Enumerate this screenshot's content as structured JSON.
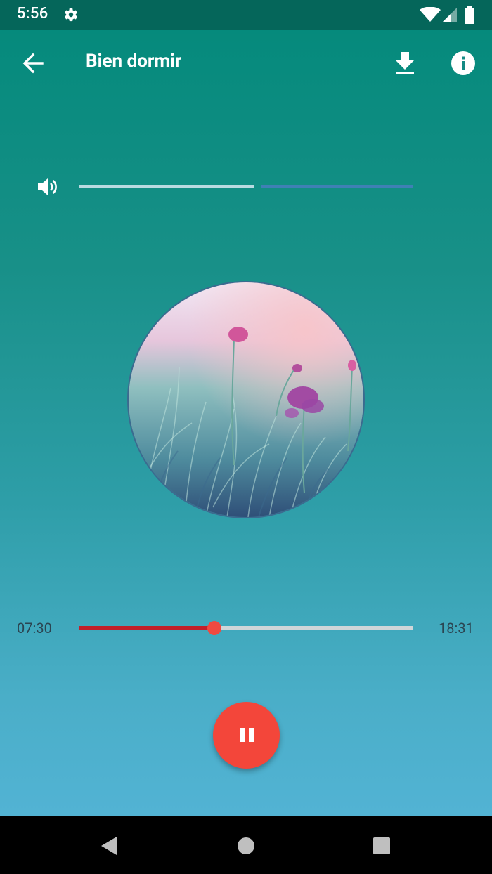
{
  "status_bar": {
    "time": "5:56",
    "icons": [
      "gear-icon",
      "wifi-icon",
      "cellular-signal-icon",
      "battery-icon"
    ]
  },
  "toolbar": {
    "title": "Bien dormir",
    "back_icon": "arrow-left-icon",
    "download_icon": "download-icon",
    "info_icon": "info-icon"
  },
  "volume": {
    "icon": "volume-icon",
    "level": 0.53
  },
  "player": {
    "elapsed": "07:30",
    "total": "18:31",
    "progress": 0.405,
    "control_icon": "pause-icon"
  },
  "nav_bar": {
    "icons": [
      "nav-back-icon",
      "nav-home-icon",
      "nav-recents-icon"
    ]
  },
  "colors": {
    "status_bar": "#05665a",
    "gradient_top": "#058a7c",
    "gradient_bottom": "#52b3d4",
    "accent_red": "#f3463a",
    "progress_fill": "#c21f2a"
  }
}
